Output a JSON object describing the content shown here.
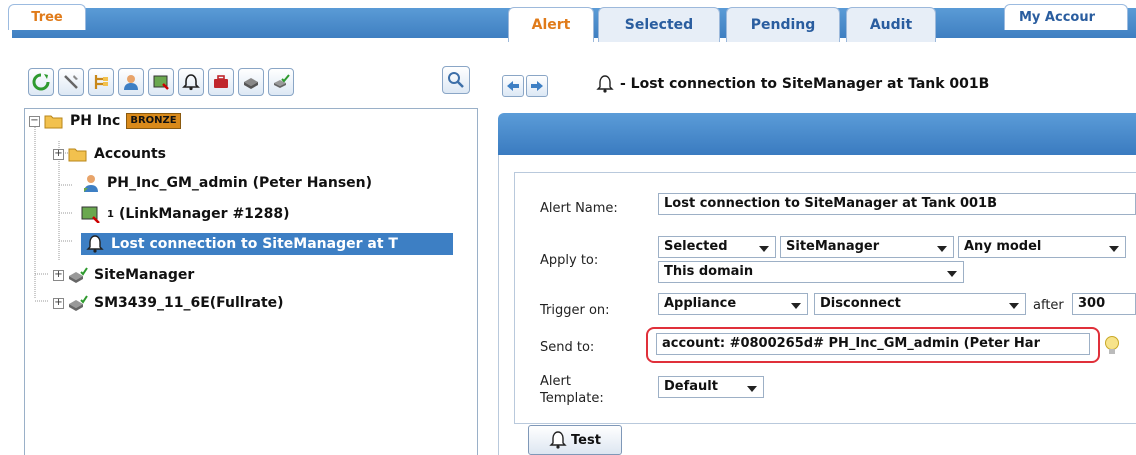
{
  "top_tabs": {
    "tree_label": "Tree",
    "account_label": "My Accour"
  },
  "toolbar": {
    "icons": [
      "refresh-icon",
      "settings-tools-icon",
      "tree-view-icon",
      "user-icon",
      "linkmanager-icon",
      "alert-bell-icon",
      "toolbox-icon",
      "sitemanager-icon",
      "sitemanager-check-icon"
    ],
    "search_icon": "search-icon"
  },
  "tree": {
    "root": {
      "label": "PH Inc",
      "badge": "BRONZE"
    },
    "items": [
      {
        "label": "Accounts"
      },
      {
        "label": "PH_Inc_GM_admin (Peter Hansen)"
      },
      {
        "superscript": "1",
        "label": "(LinkManager #1288)"
      },
      {
        "label": "Lost connection to SiteManager at T"
      },
      {
        "label": "SiteManager"
      },
      {
        "label": "SM3439_11_6E(Fullrate)"
      }
    ]
  },
  "header": {
    "title": "- Lost connection to SiteManager at Tank 001B"
  },
  "tabs": [
    {
      "label": "Alert"
    },
    {
      "label": "Selected"
    },
    {
      "label": "Pending"
    },
    {
      "label": "Audit"
    }
  ],
  "form": {
    "alert_name_label": "Alert Name:",
    "alert_name_value": "Lost connection to SiteManager at Tank 001B",
    "apply_to_label": "Apply to:",
    "apply_selected": "Selected",
    "apply_type": "SiteManager",
    "apply_model": "Any model",
    "apply_domain": "This domain",
    "trigger_label": "Trigger on:",
    "trigger_source": "Appliance",
    "trigger_event": "Disconnect",
    "after_label": "after",
    "after_value": "300",
    "send_to_label": "Send to:",
    "send_to_value": "account: #0800265d# PH_Inc_GM_admin (Peter Har",
    "template_label_line1": "Alert",
    "template_label_line2": "Template:",
    "template_value": "Default"
  },
  "test_button_label": "Test",
  "colors": {
    "accent_orange": "#e07b1a",
    "tab_blue": "#3f7fc1",
    "selection_blue": "#3d7fc4",
    "highlight_red": "#e0303a",
    "badge_orange": "#d98a1b"
  }
}
